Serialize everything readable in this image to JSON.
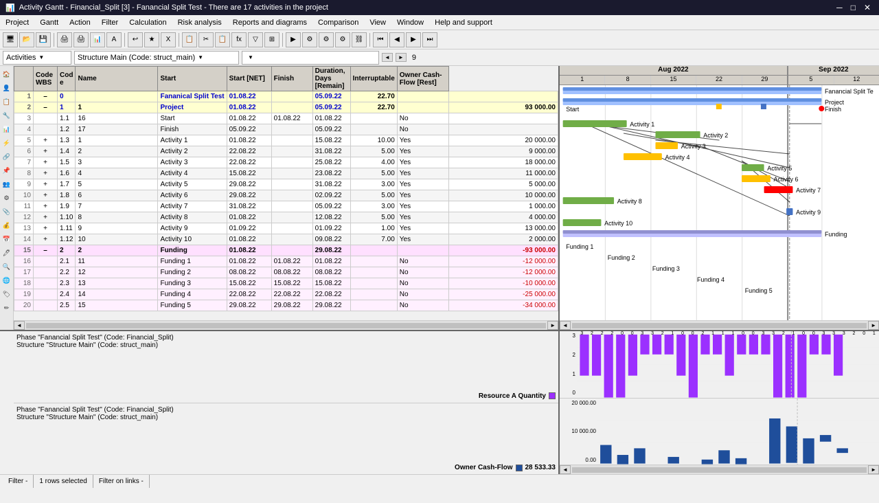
{
  "title_bar": {
    "icon": "📊",
    "title": "Activity Gantt - Financial_Split [3] - Fanancial Split Test - There are 17 activities in the project",
    "minimize": "─",
    "maximize": "□",
    "close": "✕"
  },
  "menu": {
    "items": [
      "Project",
      "Gantt",
      "Action",
      "Filter",
      "Calculation",
      "Risk analysis",
      "Reports and diagrams",
      "Comparison",
      "View",
      "Window",
      "Help and support"
    ]
  },
  "filter_row": {
    "dropdown1": "Activities",
    "dropdown2": "Structure Main (Code: struct_main)",
    "dropdown3": "",
    "nav_left": "◄",
    "nav_right": "►",
    "page_num": "9"
  },
  "table": {
    "headers": [
      "",
      "Code WBS",
      "Cod e",
      "Name",
      "Start",
      "Start [NET]",
      "Finish",
      "Duration, Days [Remain]",
      "Interruptable",
      "Owner Cash-Flow [Rest]"
    ],
    "rows": [
      {
        "num": "1",
        "expand": "–",
        "wbs": "0",
        "code": "",
        "name": "Fananical Split Test",
        "start": "01.08.22",
        "start_net": "",
        "finish": "05.09.22",
        "duration": "22.70",
        "interruptable": "",
        "cashflow": "",
        "style": "summary"
      },
      {
        "num": "2",
        "expand": "–",
        "wbs": "1",
        "code": "1",
        "name": "Project",
        "start": "01.08.22",
        "start_net": "",
        "finish": "05.09.22",
        "duration": "22.70",
        "interruptable": "",
        "cashflow": "93 000.00",
        "style": "summary"
      },
      {
        "num": "3",
        "expand": "",
        "wbs": "1.1",
        "code": "16",
        "name": "Start",
        "start": "01.08.22",
        "start_net": "01.08.22",
        "finish": "01.08.22",
        "duration": "",
        "interruptable": "No",
        "cashflow": "",
        "style": "normal"
      },
      {
        "num": "4",
        "expand": "",
        "wbs": "1.2",
        "code": "17",
        "name": "Finish",
        "start": "05.09.22",
        "start_net": "",
        "finish": "05.09.22",
        "duration": "",
        "interruptable": "No",
        "cashflow": "",
        "style": "normal"
      },
      {
        "num": "5",
        "expand": "+",
        "wbs": "1.3",
        "code": "1",
        "name": "Activity 1",
        "start": "01.08.22",
        "start_net": "",
        "finish": "15.08.22",
        "duration": "10.00",
        "interruptable": "Yes",
        "cashflow": "20 000.00",
        "style": "normal"
      },
      {
        "num": "6",
        "expand": "+",
        "wbs": "1.4",
        "code": "2",
        "name": "Activity 2",
        "start": "22.08.22",
        "start_net": "",
        "finish": "31.08.22",
        "duration": "5.00",
        "interruptable": "Yes",
        "cashflow": "9 000.00",
        "style": "normal"
      },
      {
        "num": "7",
        "expand": "+",
        "wbs": "1.5",
        "code": "3",
        "name": "Activity 3",
        "start": "22.08.22",
        "start_net": "",
        "finish": "25.08.22",
        "duration": "4.00",
        "interruptable": "Yes",
        "cashflow": "18 000.00",
        "style": "normal"
      },
      {
        "num": "8",
        "expand": "+",
        "wbs": "1.6",
        "code": "4",
        "name": "Activity 4",
        "start": "15.08.22",
        "start_net": "",
        "finish": "23.08.22",
        "duration": "5.00",
        "interruptable": "Yes",
        "cashflow": "11 000.00",
        "style": "normal"
      },
      {
        "num": "9",
        "expand": "+",
        "wbs": "1.7",
        "code": "5",
        "name": "Activity 5",
        "start": "29.08.22",
        "start_net": "",
        "finish": "31.08.22",
        "duration": "3.00",
        "interruptable": "Yes",
        "cashflow": "5 000.00",
        "style": "normal"
      },
      {
        "num": "10",
        "expand": "+",
        "wbs": "1.8",
        "code": "6",
        "name": "Activity 6",
        "start": "29.08.22",
        "start_net": "",
        "finish": "02.09.22",
        "duration": "5.00",
        "interruptable": "Yes",
        "cashflow": "10 000.00",
        "style": "normal"
      },
      {
        "num": "11",
        "expand": "+",
        "wbs": "1.9",
        "code": "7",
        "name": "Activity 7",
        "start": "31.08.22",
        "start_net": "",
        "finish": "05.09.22",
        "duration": "3.00",
        "interruptable": "Yes",
        "cashflow": "1 000.00",
        "style": "normal"
      },
      {
        "num": "12",
        "expand": "+",
        "wbs": "1.10",
        "code": "8",
        "name": "Activity 8",
        "start": "01.08.22",
        "start_net": "",
        "finish": "12.08.22",
        "duration": "5.00",
        "interruptable": "Yes",
        "cashflow": "4 000.00",
        "style": "normal"
      },
      {
        "num": "13",
        "expand": "+",
        "wbs": "1.11",
        "code": "9",
        "name": "Activity 9",
        "start": "01.09.22",
        "start_net": "",
        "finish": "01.09.22",
        "duration": "1.00",
        "interruptable": "Yes",
        "cashflow": "13 000.00",
        "style": "normal"
      },
      {
        "num": "14",
        "expand": "+",
        "wbs": "1.12",
        "code": "10",
        "name": "Activity 10",
        "start": "01.08.22",
        "start_net": "",
        "finish": "09.08.22",
        "duration": "7.00",
        "interruptable": "Yes",
        "cashflow": "2 000.00",
        "style": "normal"
      },
      {
        "num": "15",
        "expand": "–",
        "wbs": "2",
        "code": "2",
        "name": "Funding",
        "start": "01.08.22",
        "start_net": "",
        "finish": "29.08.22",
        "duration": "",
        "interruptable": "",
        "cashflow": "-93 000.00",
        "style": "funding-summary"
      },
      {
        "num": "16",
        "expand": "",
        "wbs": "2.1",
        "code": "11",
        "name": "Funding 1",
        "start": "01.08.22",
        "start_net": "01.08.22",
        "finish": "01.08.22",
        "duration": "",
        "interruptable": "No",
        "cashflow": "-12 000.00",
        "style": "funding"
      },
      {
        "num": "17",
        "expand": "",
        "wbs": "2.2",
        "code": "12",
        "name": "Funding 2",
        "start": "08.08.22",
        "start_net": "08.08.22",
        "finish": "08.08.22",
        "duration": "",
        "interruptable": "No",
        "cashflow": "-12 000.00",
        "style": "funding"
      },
      {
        "num": "18",
        "expand": "",
        "wbs": "2.3",
        "code": "13",
        "name": "Funding 3",
        "start": "15.08.22",
        "start_net": "15.08.22",
        "finish": "15.08.22",
        "duration": "",
        "interruptable": "No",
        "cashflow": "-10 000.00",
        "style": "funding"
      },
      {
        "num": "19",
        "expand": "",
        "wbs": "2.4",
        "code": "14",
        "name": "Funding 4",
        "start": "22.08.22",
        "start_net": "22.08.22",
        "finish": "22.08.22",
        "duration": "",
        "interruptable": "No",
        "cashflow": "-25 000.00",
        "style": "funding"
      },
      {
        "num": "20",
        "expand": "",
        "wbs": "2.5",
        "code": "15",
        "name": "Funding 5",
        "start": "29.08.22",
        "start_net": "29.08.22",
        "finish": "29.08.22",
        "duration": "",
        "interruptable": "No",
        "cashflow": "-34 000.00",
        "style": "funding"
      }
    ]
  },
  "gantt": {
    "months": [
      {
        "label": "Aug 2022",
        "days": [
          "1",
          "8",
          "15",
          "22",
          "29"
        ]
      },
      {
        "label": "Sep 2022",
        "days": [
          "5",
          "12"
        ]
      }
    ]
  },
  "bottom_panels": {
    "panel1_line1": "Phase \"Fanancial Split Test\" (Code: Financial_Split)",
    "panel1_line2": "Structure \"Structure Main\" (Code: struct_main)",
    "panel2_line1": "Phase \"Fanancial Split Test\" (Code: Financial_Split)",
    "panel2_line2": "Structure \"Structure Main\" (Code: struct_main)",
    "resource_label": "Resource A Quantity",
    "cashflow_label": "Owner Cash-Flow",
    "cashflow_value": "28 533.33",
    "resource_max": "3",
    "resource_mid": "2",
    "resource_low": "1",
    "resource_zero": "0",
    "cashflow_max": "20 000.00",
    "cashflow_mid": "10 000.00",
    "cashflow_zero": "0.00"
  },
  "status_bar": {
    "filter": "Filter -",
    "selected": "1 rows selected",
    "filter_links": "Filter on links -"
  },
  "colors": {
    "summary_bg": "#ffffd0",
    "funding_bg": "#ffe8ff",
    "selected_bg": "#b8d4f0",
    "header_bg": "#d4d0c8",
    "bar_green": "#70ad47",
    "bar_blue": "#4472c4",
    "bar_orange": "#ffc000",
    "bar_red": "#ff0000",
    "bar_teal": "#17a589",
    "bar_purple": "#9b30ff",
    "bar_darkblue": "#1f4e9b"
  }
}
